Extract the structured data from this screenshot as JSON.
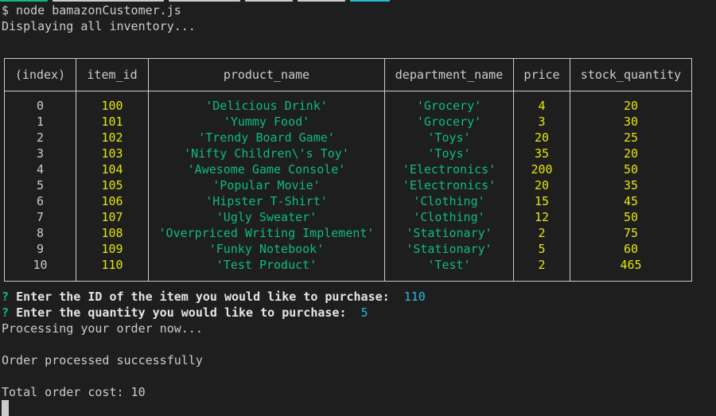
{
  "terminal": {
    "command_line": "$ node bamazonCustomer.js",
    "status_line": "Displaying all inventory..."
  },
  "colors": {
    "background": "#1e1e1e",
    "text": "#cccccc",
    "green": "#0dbc79",
    "yellow": "#e5e510",
    "cyan": "#29b8db"
  },
  "table": {
    "headers": [
      "(index)",
      "item_id",
      "product_name",
      "department_name",
      "price",
      "stock_quantity"
    ],
    "rows": [
      [
        "0",
        "100",
        "'Delicious Drink'",
        "'Grocery'",
        "4",
        "20"
      ],
      [
        "1",
        "101",
        "'Yummy Food'",
        "'Grocery'",
        "3",
        "30"
      ],
      [
        "2",
        "102",
        "'Trendy Board Game'",
        "'Toys'",
        "20",
        "25"
      ],
      [
        "3",
        "103",
        "'Nifty Children\\'s Toy'",
        "'Toys'",
        "35",
        "20"
      ],
      [
        "4",
        "104",
        "'Awesome Game Console'",
        "'Electronics'",
        "200",
        "50"
      ],
      [
        "5",
        "105",
        "'Popular Movie'",
        "'Electronics'",
        "20",
        "35"
      ],
      [
        "6",
        "106",
        "'Hipster T-Shirt'",
        "'Clothing'",
        "15",
        "45"
      ],
      [
        "7",
        "107",
        "'Ugly Sweater'",
        "'Clothing'",
        "12",
        "50"
      ],
      [
        "8",
        "108",
        "'Overpriced Writing Implement'",
        "'Stationary'",
        "2",
        "75"
      ],
      [
        "9",
        "109",
        "'Funky Notebook'",
        "'Stationary'",
        "5",
        "60"
      ],
      [
        "10",
        "110",
        "'Test Product'",
        "'Test'",
        "2",
        "465"
      ]
    ]
  },
  "prompts": [
    {
      "marker": "?",
      "question": "Enter the ID of the item you would like to purchase:",
      "answer": "110"
    },
    {
      "marker": "?",
      "question": "Enter the quantity you would like to purchase:",
      "answer": "5"
    }
  ],
  "output": {
    "processing": "Processing your order now...",
    "success": "Order processed successfully",
    "total": "Total order cost: 10"
  }
}
